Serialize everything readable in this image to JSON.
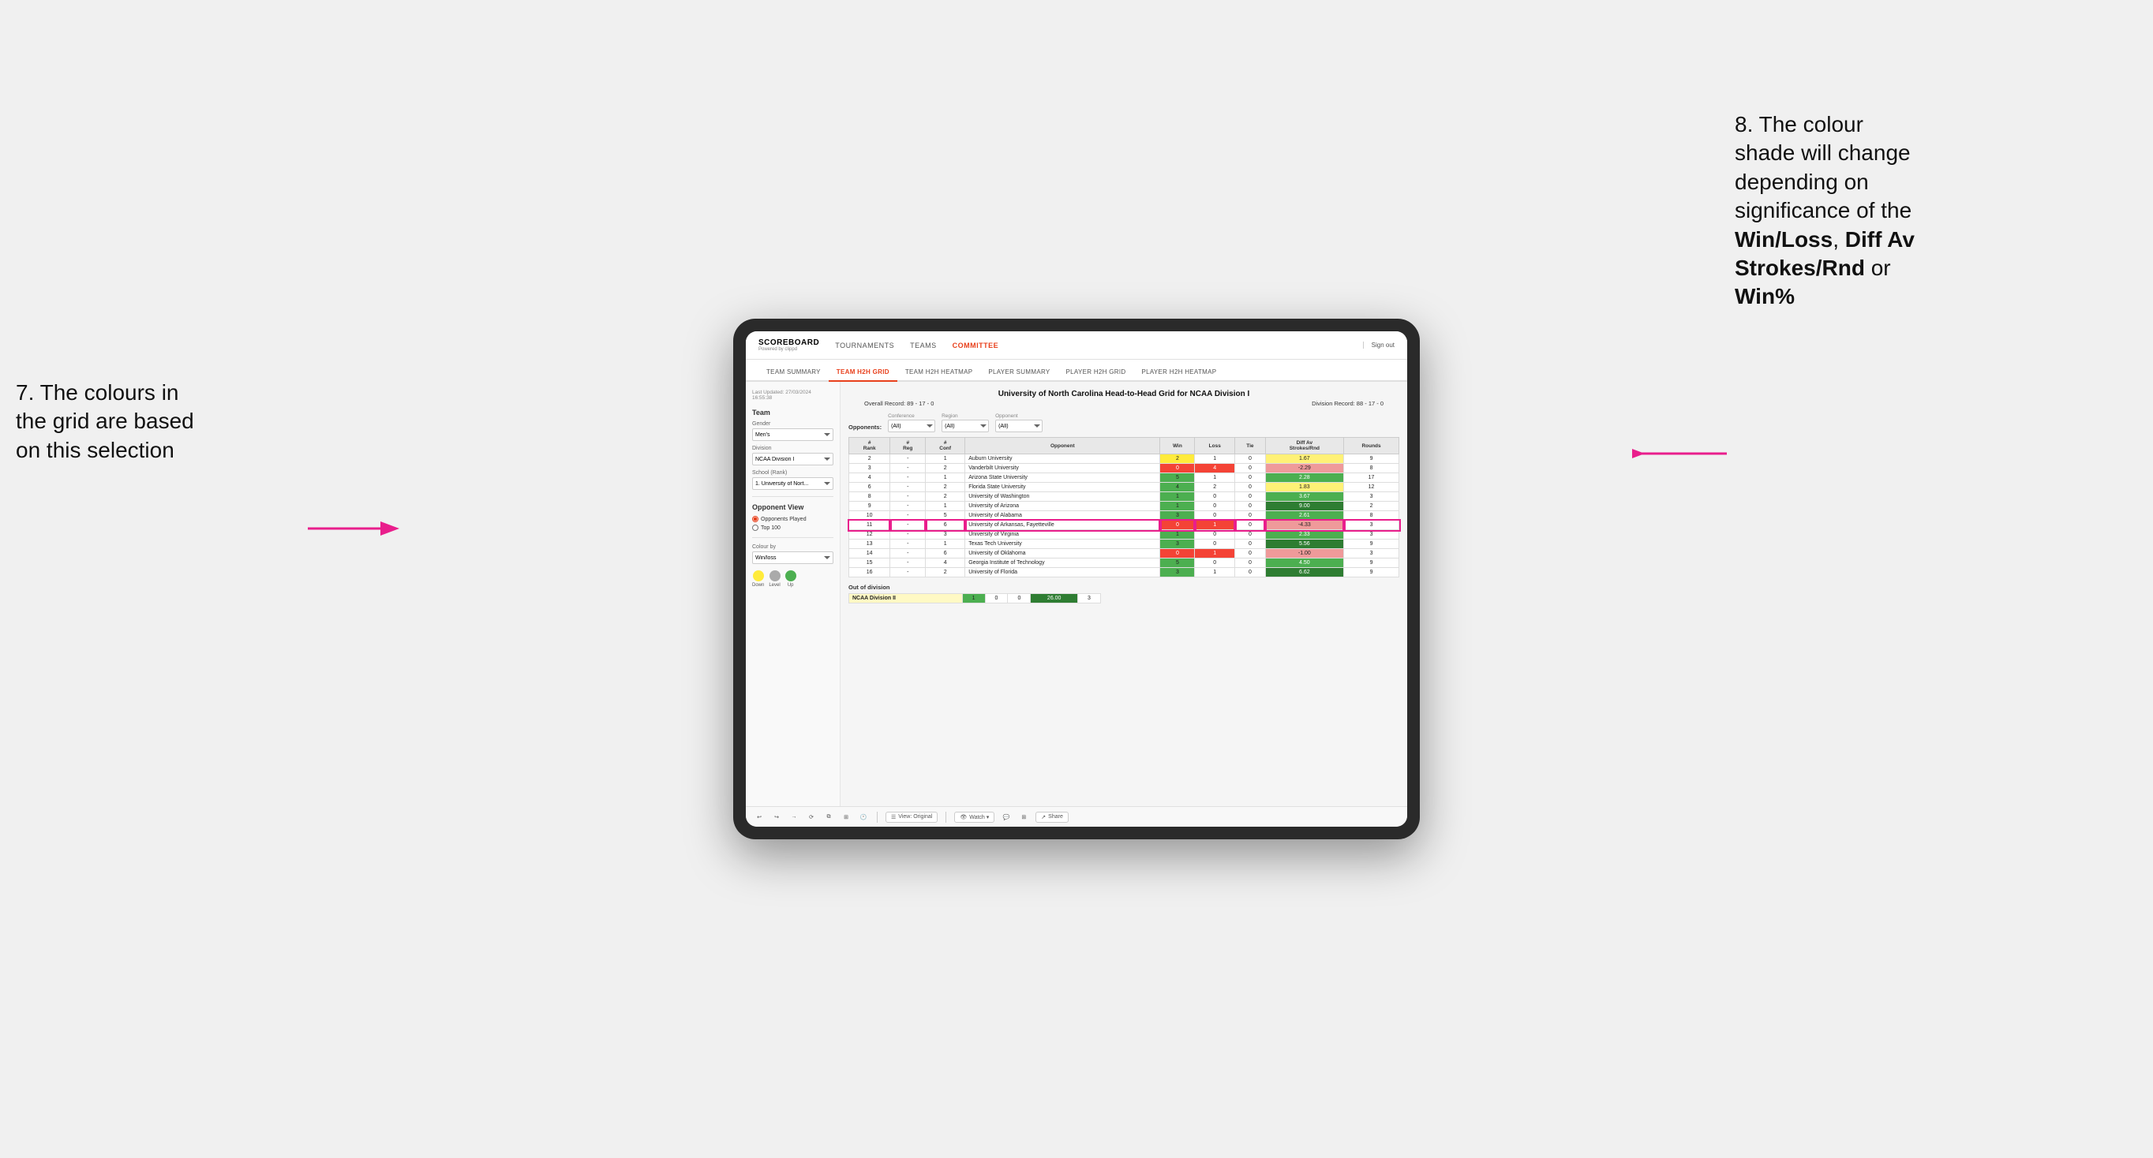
{
  "app": {
    "logo": "SCOREBOARD",
    "logo_sub": "Powered by clippd",
    "sign_out": "Sign out"
  },
  "nav": {
    "items": [
      "TOURNAMENTS",
      "TEAMS",
      "COMMITTEE"
    ]
  },
  "sub_nav": {
    "items": [
      "TEAM SUMMARY",
      "TEAM H2H GRID",
      "TEAM H2H HEATMAP",
      "PLAYER SUMMARY",
      "PLAYER H2H GRID",
      "PLAYER H2H HEATMAP"
    ],
    "active": "TEAM H2H GRID"
  },
  "sidebar": {
    "timestamp_label": "Last Updated: 27/03/2024",
    "timestamp_time": "16:55:38",
    "team_section": "Team",
    "gender_label": "Gender",
    "gender_value": "Men's",
    "division_label": "Division",
    "division_value": "NCAA Division I",
    "school_label": "School (Rank)",
    "school_value": "1. University of Nort...",
    "opponent_view_label": "Opponent View",
    "radio1": "Opponents Played",
    "radio2": "Top 100",
    "colour_by_label": "Colour by",
    "colour_by_value": "Win/loss",
    "colours": [
      {
        "label": "Down",
        "color": "#ffeb3b"
      },
      {
        "label": "Level",
        "color": "#aaaaaa"
      },
      {
        "label": "Up",
        "color": "#4caf50"
      }
    ]
  },
  "grid": {
    "title": "University of North Carolina Head-to-Head Grid for NCAA Division I",
    "overall_record": "Overall Record: 89 - 17 - 0",
    "division_record": "Division Record: 88 - 17 - 0",
    "filters": {
      "opponents_label": "Opponents:",
      "conference_label": "Conference",
      "conference_value": "(All)",
      "region_label": "Region",
      "region_value": "(All)",
      "opponent_label": "Opponent",
      "opponent_value": "(All)"
    },
    "columns": [
      "#\nRank",
      "#\nReg",
      "#\nConf",
      "Opponent",
      "Win",
      "Loss",
      "Tie",
      "Diff Av\nStrokes/Rnd",
      "Rounds"
    ],
    "rows": [
      {
        "rank": "2",
        "reg": "-",
        "conf": "1",
        "opponent": "Auburn University",
        "win": "2",
        "loss": "1",
        "tie": "0",
        "diff": "1.67",
        "rounds": "9",
        "win_class": "win-cell-yellow",
        "loss_class": "",
        "diff_class": "diff-yellow"
      },
      {
        "rank": "3",
        "reg": "-",
        "conf": "2",
        "opponent": "Vanderbilt University",
        "win": "0",
        "loss": "4",
        "tie": "0",
        "diff": "-2.29",
        "rounds": "8",
        "win_class": "win-cell-red",
        "loss_class": "loss-cell-red",
        "diff_class": "diff-red"
      },
      {
        "rank": "4",
        "reg": "-",
        "conf": "1",
        "opponent": "Arizona State University",
        "win": "5",
        "loss": "1",
        "tie": "0",
        "diff": "2.28",
        "rounds": "17",
        "win_class": "win-cell-green",
        "loss_class": "",
        "diff_class": "diff-green"
      },
      {
        "rank": "6",
        "reg": "-",
        "conf": "2",
        "opponent": "Florida State University",
        "win": "4",
        "loss": "2",
        "tie": "0",
        "diff": "1.83",
        "rounds": "12",
        "win_class": "win-cell-green",
        "loss_class": "",
        "diff_class": "diff-yellow"
      },
      {
        "rank": "8",
        "reg": "-",
        "conf": "2",
        "opponent": "University of Washington",
        "win": "1",
        "loss": "0",
        "tie": "0",
        "diff": "3.67",
        "rounds": "3",
        "win_class": "win-cell-green",
        "loss_class": "",
        "diff_class": "diff-green"
      },
      {
        "rank": "9",
        "reg": "-",
        "conf": "1",
        "opponent": "University of Arizona",
        "win": "1",
        "loss": "0",
        "tie": "0",
        "diff": "9.00",
        "rounds": "2",
        "win_class": "win-cell-green",
        "loss_class": "",
        "diff_class": "diff-green-dark"
      },
      {
        "rank": "10",
        "reg": "-",
        "conf": "5",
        "opponent": "University of Alabama",
        "win": "3",
        "loss": "0",
        "tie": "0",
        "diff": "2.61",
        "rounds": "8",
        "win_class": "win-cell-green",
        "loss_class": "",
        "diff_class": "diff-green"
      },
      {
        "rank": "11",
        "reg": "-",
        "conf": "6",
        "opponent": "University of Arkansas, Fayetteville",
        "win": "0",
        "loss": "1",
        "tie": "0",
        "diff": "-4.33",
        "rounds": "3",
        "win_class": "win-cell-red",
        "loss_class": "loss-cell-red",
        "diff_class": "diff-red",
        "highlight": true
      },
      {
        "rank": "12",
        "reg": "-",
        "conf": "3",
        "opponent": "University of Virginia",
        "win": "1",
        "loss": "0",
        "tie": "0",
        "diff": "2.33",
        "rounds": "3",
        "win_class": "win-cell-green",
        "loss_class": "",
        "diff_class": "diff-green"
      },
      {
        "rank": "13",
        "reg": "-",
        "conf": "1",
        "opponent": "Texas Tech University",
        "win": "3",
        "loss": "0",
        "tie": "0",
        "diff": "5.56",
        "rounds": "9",
        "win_class": "win-cell-green",
        "loss_class": "",
        "diff_class": "diff-green-dark"
      },
      {
        "rank": "14",
        "reg": "-",
        "conf": "6",
        "opponent": "University of Oklahoma",
        "win": "0",
        "loss": "1",
        "tie": "0",
        "diff": "-1.00",
        "rounds": "3",
        "win_class": "win-cell-red",
        "loss_class": "loss-cell-red",
        "diff_class": "diff-red"
      },
      {
        "rank": "15",
        "reg": "-",
        "conf": "4",
        "opponent": "Georgia Institute of Technology",
        "win": "5",
        "loss": "0",
        "tie": "0",
        "diff": "4.50",
        "rounds": "9",
        "win_class": "win-cell-green",
        "loss_class": "",
        "diff_class": "diff-green"
      },
      {
        "rank": "16",
        "reg": "-",
        "conf": "2",
        "opponent": "University of Florida",
        "win": "3",
        "loss": "1",
        "tie": "0",
        "diff": "6.62",
        "rounds": "9",
        "win_class": "win-cell-green",
        "loss_class": "",
        "diff_class": "diff-green-dark"
      }
    ],
    "out_of_division_label": "Out of division",
    "out_of_div_row": {
      "label": "NCAA Division II",
      "win": "1",
      "loss": "0",
      "tie": "0",
      "diff": "26.00",
      "rounds": "3"
    }
  },
  "annotations": {
    "left_text_1": "7. The colours in",
    "left_text_2": "the grid are based",
    "left_text_3": "on this selection",
    "right_text_1": "8. The colour",
    "right_text_2": "shade will change",
    "right_text_3": "depending on",
    "right_text_4": "significance of the",
    "right_bold_1": "Win/Loss",
    "right_comma_1": ", ",
    "right_bold_2": "Diff Av",
    "right_text_5": "Strokes/Rnd",
    "right_text_6": " or",
    "right_bold_3": "Win%"
  },
  "toolbar": {
    "view_label": "View: Original",
    "watch_label": "Watch ▾",
    "share_label": "Share"
  }
}
